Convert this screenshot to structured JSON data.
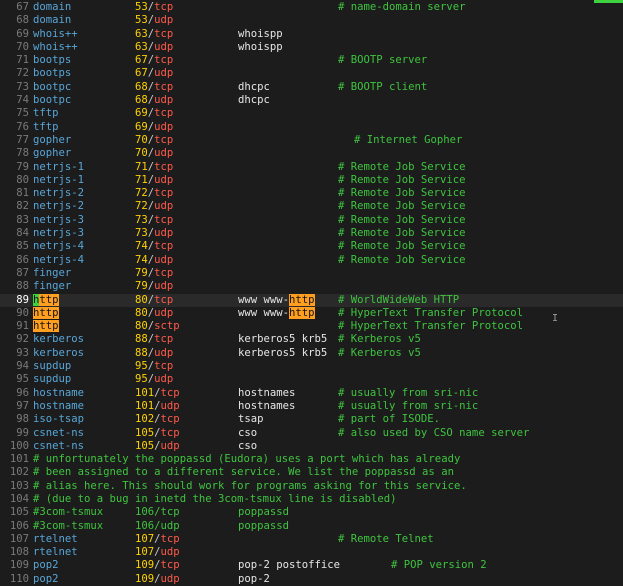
{
  "editor": {
    "lines": [
      {
        "n": "67",
        "name": "domain",
        "num": "53",
        "proto": "tcp",
        "alias": "",
        "comment": "# name-domain server"
      },
      {
        "n": "68",
        "name": "domain",
        "num": "53",
        "proto": "udp",
        "alias": "",
        "comment": ""
      },
      {
        "n": "69",
        "name": "whois++",
        "num": "63",
        "proto": "tcp",
        "alias": "whoispp",
        "comment": ""
      },
      {
        "n": "70",
        "name": "whois++",
        "num": "63",
        "proto": "udp",
        "alias": "whoispp",
        "comment": ""
      },
      {
        "n": "71",
        "name": "bootps",
        "num": "67",
        "proto": "tcp",
        "alias": "",
        "comment": "# BOOTP server"
      },
      {
        "n": "72",
        "name": "bootps",
        "num": "67",
        "proto": "udp",
        "alias": "",
        "comment": ""
      },
      {
        "n": "73",
        "name": "bootpc",
        "num": "68",
        "proto": "tcp",
        "alias": "dhcpc",
        "comment": "# BOOTP client"
      },
      {
        "n": "74",
        "name": "bootpc",
        "num": "68",
        "proto": "udp",
        "alias": "dhcpc",
        "comment": ""
      },
      {
        "n": "75",
        "name": "tftp",
        "num": "69",
        "proto": "tcp",
        "alias": "",
        "comment": ""
      },
      {
        "n": "76",
        "name": "tftp",
        "num": "69",
        "proto": "udp",
        "alias": "",
        "comment": ""
      },
      {
        "n": "77",
        "name": "gopher",
        "num": "70",
        "proto": "tcp",
        "alias": "",
        "comment": "# Internet Gopher"
      },
      {
        "n": "78",
        "name": "gopher",
        "num": "70",
        "proto": "udp",
        "alias": "",
        "comment": ""
      },
      {
        "n": "79",
        "name": "netrjs-1",
        "num": "71",
        "proto": "tcp",
        "alias": "",
        "comment": "# Remote Job Service"
      },
      {
        "n": "80",
        "name": "netrjs-1",
        "num": "71",
        "proto": "udp",
        "alias": "",
        "comment": "# Remote Job Service"
      },
      {
        "n": "81",
        "name": "netrjs-2",
        "num": "72",
        "proto": "tcp",
        "alias": "",
        "comment": "# Remote Job Service"
      },
      {
        "n": "82",
        "name": "netrjs-2",
        "num": "72",
        "proto": "udp",
        "alias": "",
        "comment": "# Remote Job Service"
      },
      {
        "n": "83",
        "name": "netrjs-3",
        "num": "73",
        "proto": "tcp",
        "alias": "",
        "comment": "# Remote Job Service"
      },
      {
        "n": "84",
        "name": "netrjs-3",
        "num": "73",
        "proto": "udp",
        "alias": "",
        "comment": "# Remote Job Service"
      },
      {
        "n": "85",
        "name": "netrjs-4",
        "num": "74",
        "proto": "tcp",
        "alias": "",
        "comment": "# Remote Job Service"
      },
      {
        "n": "86",
        "name": "netrjs-4",
        "num": "74",
        "proto": "udp",
        "alias": "",
        "comment": "# Remote Job Service"
      },
      {
        "n": "87",
        "name": "finger",
        "num": "79",
        "proto": "tcp",
        "alias": "",
        "comment": ""
      },
      {
        "n": "88",
        "name": "finger",
        "num": "79",
        "proto": "udp",
        "alias": "",
        "comment": ""
      },
      {
        "n": "89",
        "name": "http",
        "num": "80",
        "proto": "tcp",
        "alias": "www www-",
        "alias_hl": "http",
        "comment": "# WorldWideWeb HTTP",
        "cursor": true,
        "name_hl": true
      },
      {
        "n": "90",
        "name": "http",
        "num": "80",
        "proto": "udp",
        "alias": "www www-",
        "alias_hl": "http",
        "comment": "# HyperText Transfer Protocol",
        "name_hl": true
      },
      {
        "n": "91",
        "name": "http",
        "num": "80",
        "proto": "sctp",
        "alias": "",
        "comment": "# HyperText Transfer Protocol",
        "name_hl": true
      },
      {
        "n": "92",
        "name": "kerberos",
        "num": "88",
        "proto": "tcp",
        "alias": "kerberos5 krb5",
        "comment": "# Kerberos v5"
      },
      {
        "n": "93",
        "name": "kerberos",
        "num": "88",
        "proto": "udp",
        "alias": "kerberos5 krb5",
        "comment": "# Kerberos v5"
      },
      {
        "n": "94",
        "name": "supdup",
        "num": "95",
        "proto": "tcp",
        "alias": "",
        "comment": ""
      },
      {
        "n": "95",
        "name": "supdup",
        "num": "95",
        "proto": "udp",
        "alias": "",
        "comment": ""
      },
      {
        "n": "96",
        "name": "hostname",
        "num": "101",
        "proto": "tcp",
        "alias": "hostnames",
        "comment": "# usually from sri-nic"
      },
      {
        "n": "97",
        "name": "hostname",
        "num": "101",
        "proto": "udp",
        "alias": "hostnames",
        "comment": "# usually from sri-nic"
      },
      {
        "n": "98",
        "name": "iso-tsap",
        "num": "102",
        "proto": "tcp",
        "alias": "tsap",
        "comment": "# part of ISODE."
      },
      {
        "n": "99",
        "name": "csnet-ns",
        "num": "105",
        "proto": "tcp",
        "alias": "cso",
        "comment": "# also used by CSO name server"
      },
      {
        "n": "100",
        "name": "csnet-ns",
        "num": "105",
        "proto": "udp",
        "alias": "cso",
        "comment": ""
      },
      {
        "n": "101",
        "full": "# unfortunately the poppassd (Eudora) uses a port which has already"
      },
      {
        "n": "102",
        "full": "# been assigned to a different service. We list the poppassd as an"
      },
      {
        "n": "103",
        "full": "# alias here. This should work for programs asking for this service."
      },
      {
        "n": "104",
        "full": "# (due to a bug in inetd the 3com-tsmux line is disabled)"
      },
      {
        "n": "105",
        "name": "#3com-tsmux",
        "num": "106",
        "proto": "tcp",
        "alias": "poppassd",
        "comment": "",
        "commented": true
      },
      {
        "n": "106",
        "name": "#3com-tsmux",
        "num": "106",
        "proto": "udp",
        "alias": "poppassd",
        "comment": "",
        "commented": true
      },
      {
        "n": "107",
        "name": "rtelnet",
        "num": "107",
        "proto": "tcp",
        "alias": "",
        "comment": "# Remote Telnet"
      },
      {
        "n": "108",
        "name": "rtelnet",
        "num": "107",
        "proto": "udp",
        "alias": "",
        "comment": ""
      },
      {
        "n": "109",
        "name": "pop2",
        "num": "109",
        "proto": "tcp",
        "alias": "pop-2 postoffice",
        "comment": "# POP version 2",
        "comment_far": true
      },
      {
        "n": "110",
        "name": "pop2",
        "num": "109",
        "proto": "udp",
        "alias": "pop-2",
        "comment": ""
      }
    ],
    "colors": {
      "background": "#1c1c1c",
      "line_number": "#7a7a7a",
      "service_name": "#58a6d8",
      "port_number": "#ffd200",
      "protocol": "#ff5a4a",
      "comment": "#3fc43f",
      "search_highlight": "#ff9e1f",
      "cursor": "#3fd23f"
    },
    "icons": {
      "mouse_pointer": "text-ibeam-icon"
    }
  }
}
